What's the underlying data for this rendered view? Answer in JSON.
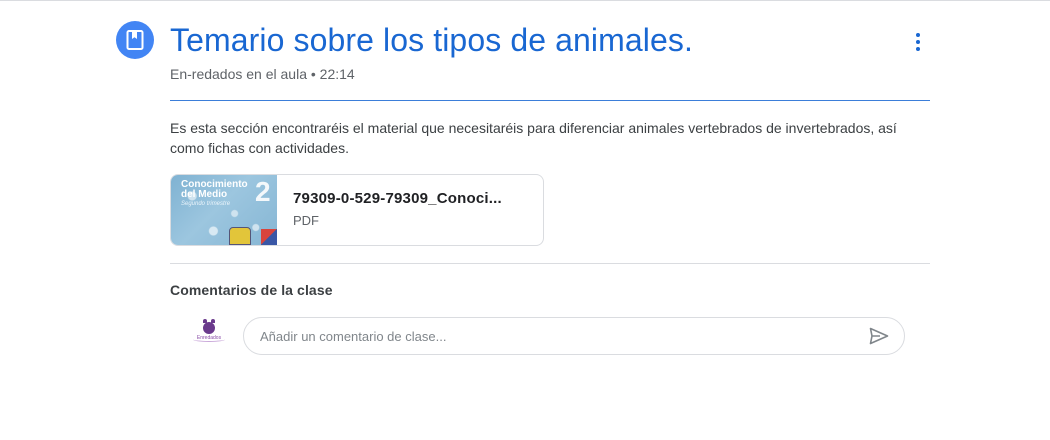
{
  "post": {
    "icon": "assignment-icon",
    "title": "Temario sobre los tipos de animales.",
    "meta": "En-redados en el aula • 22:14",
    "description": "Es esta sección encontraréis el material que necesitaréis para diferenciar animales vertebrados de invertebrados, así como fichas con actividades."
  },
  "attachment": {
    "name": "79309-0-529-79309_Conoci...",
    "type": "PDF",
    "thumbnail": {
      "title": "Conocimiento del Medio",
      "subtitle": "Segundo trimestre",
      "number": "2"
    }
  },
  "comments": {
    "title": "Comentarios de la clase",
    "placeholder": "Añadir un comentario de clase...",
    "avatar_text": "Enredados",
    "send_icon": "send-icon"
  },
  "colors": {
    "accent": "#1967d2",
    "icon_bg": "#4285f4",
    "divider": "#dadce0"
  }
}
